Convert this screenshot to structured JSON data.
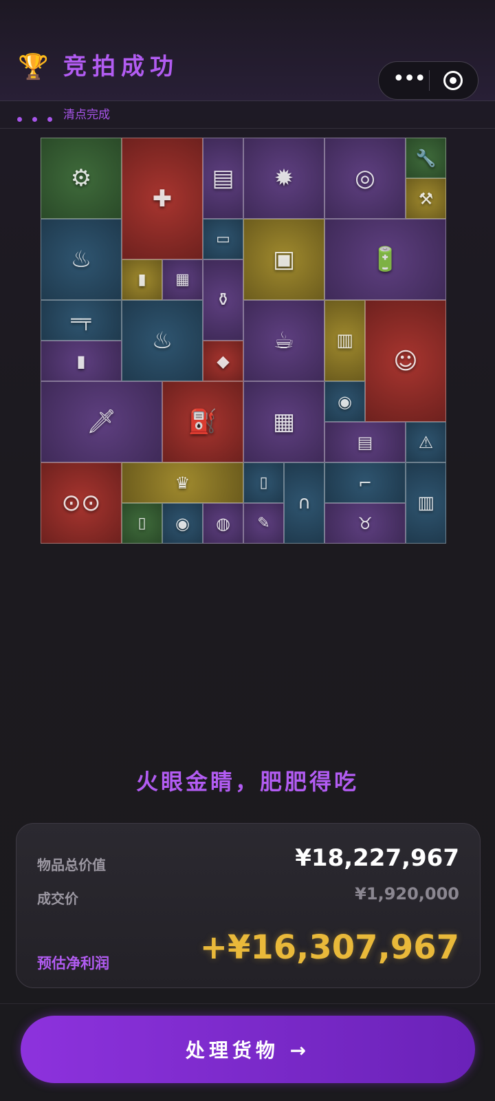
{
  "header": {
    "title": "竞拍成功",
    "trophy_icon": "trophy-icon",
    "more_icon": "more-dots-icon",
    "close_icon": "target-circle-icon"
  },
  "status": {
    "text": "清点完成"
  },
  "items": [
    {
      "name": "angle-grinder",
      "color": "green"
    },
    {
      "name": "aed-defibrillator",
      "color": "red"
    },
    {
      "name": "black-tide-book",
      "color": "purple"
    },
    {
      "name": "circular-saw",
      "color": "purple"
    },
    {
      "name": "blood-pressure-monitor",
      "color": "purple"
    },
    {
      "name": "wrench",
      "color": "green"
    },
    {
      "name": "hand-tool",
      "color": "gold"
    },
    {
      "name": "camping-stove",
      "color": "blue"
    },
    {
      "name": "usb-drive",
      "color": "blue"
    },
    {
      "name": "military-crate",
      "color": "gold"
    },
    {
      "name": "car-battery",
      "color": "purple"
    },
    {
      "name": "lighter",
      "color": "gold"
    },
    {
      "name": "circuit-chip",
      "color": "purple"
    },
    {
      "name": "hookah",
      "color": "purple"
    },
    {
      "name": "assault-rifle",
      "color": "blue"
    },
    {
      "name": "camping-stove-2",
      "color": "blue"
    },
    {
      "name": "coffee-machine",
      "color": "purple"
    },
    {
      "name": "leather-notebook",
      "color": "gold"
    },
    {
      "name": "cato-bust",
      "color": "red"
    },
    {
      "name": "armor-plate",
      "color": "purple"
    },
    {
      "name": "diamond",
      "color": "red"
    },
    {
      "name": "combat-knife",
      "color": "purple"
    },
    {
      "name": "gas-canister",
      "color": "red"
    },
    {
      "name": "motherboard",
      "color": "purple"
    },
    {
      "name": "silver-coin",
      "color": "blue"
    },
    {
      "name": "circuit-board",
      "color": "purple"
    },
    {
      "name": "warning-sign",
      "color": "blue"
    },
    {
      "name": "reel-tape-recorder",
      "color": "red"
    },
    {
      "name": "golden-crown",
      "color": "gold"
    },
    {
      "name": "pill-bottle",
      "color": "blue"
    },
    {
      "name": "stethoscope",
      "color": "blue"
    },
    {
      "name": "power-drill",
      "color": "blue"
    },
    {
      "name": "ammo-box",
      "color": "blue"
    },
    {
      "name": "water-bottle",
      "color": "green"
    },
    {
      "name": "ancient-coin",
      "color": "blue"
    },
    {
      "name": "food-tin",
      "color": "purple"
    },
    {
      "name": "syringe",
      "color": "purple"
    },
    {
      "name": "horned-helmet",
      "color": "purple"
    }
  ],
  "slogan": "火眼金睛，肥肥得吃",
  "summary": {
    "total_label": "物品总价值",
    "total_value": "¥18,227,967",
    "price_label": "成交价",
    "price_value": "¥1,920,000",
    "profit_label": "预估净利润",
    "profit_value": "+¥16,307,967"
  },
  "cta": {
    "label": "处理货物 →"
  },
  "colors": {
    "accent": "#b25cf2",
    "profit": "#e9b93a",
    "button": "#8d32dd"
  }
}
